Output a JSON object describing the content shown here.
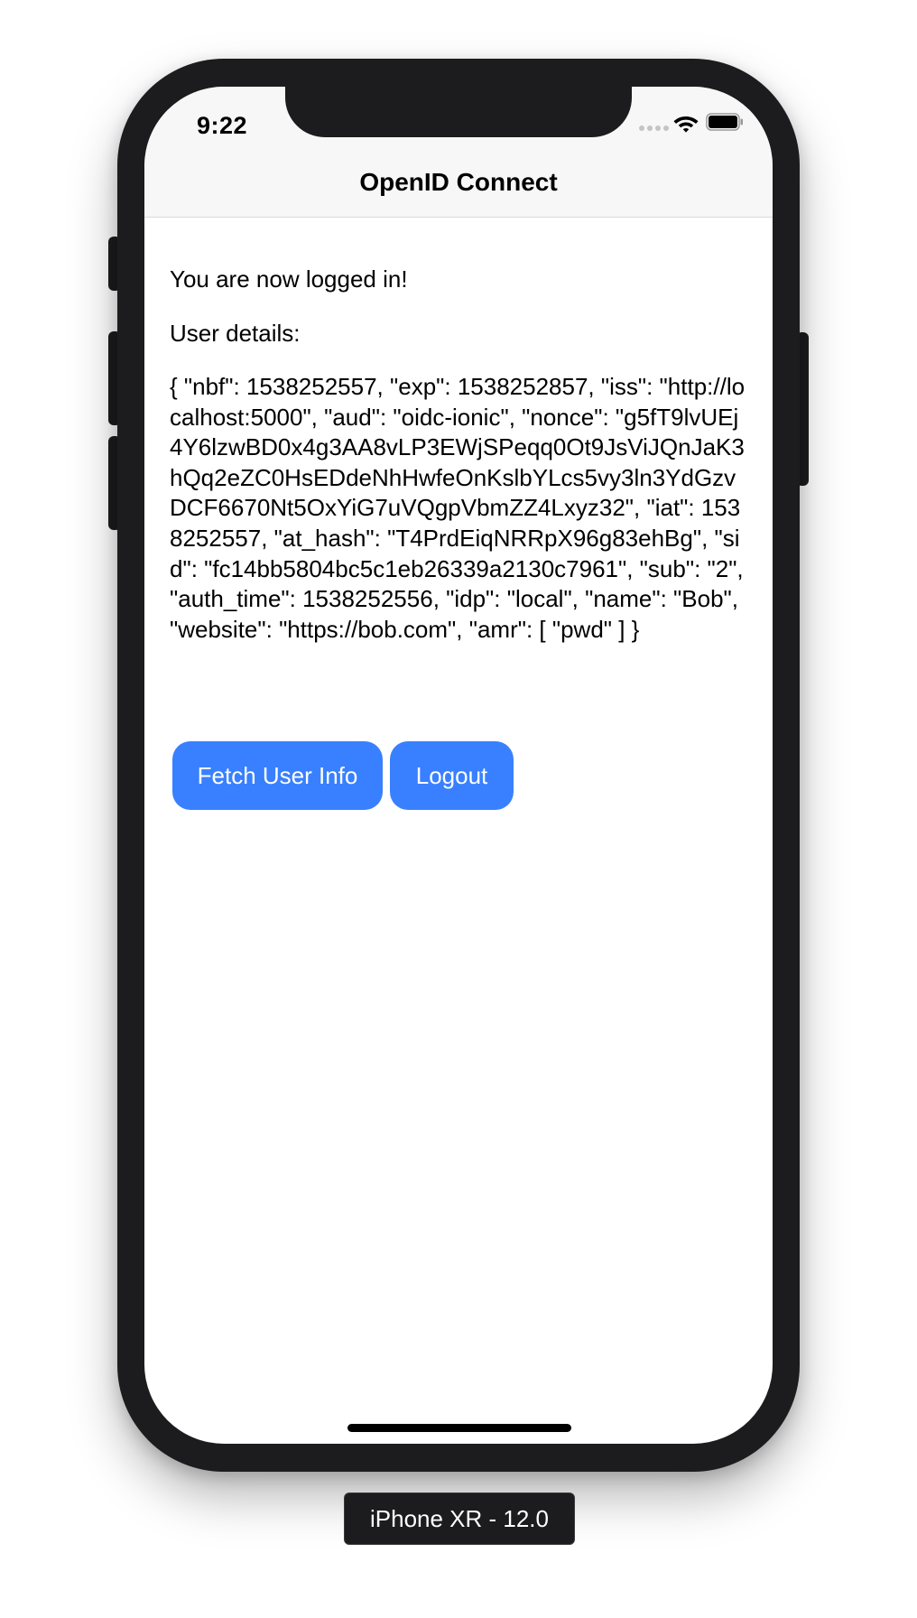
{
  "status_bar": {
    "time": "9:22"
  },
  "nav": {
    "title": "OpenID Connect"
  },
  "content": {
    "logged_in_message": "You are now logged in!",
    "details_label": "User details:",
    "details_json": "{ \"nbf\": 1538252557, \"exp\": 1538252857, \"iss\": \"http://localhost:5000\", \"aud\": \"oidc-ionic\", \"nonce\": \"g5fT9lvUEj4Y6lzwBD0x4g3AA8vLP3EWjSPeqq0Ot9JsViJQnJaK3hQq2eZC0HsEDdeNhHwfeOnKslbYLcs5vy3ln3YdGzvDCF6670Nt5OxYiG7uVQgpVbmZZ4Lxyz32\", \"iat\": 1538252557, \"at_hash\": \"T4PrdEiqNRRpX96g83ehBg\", \"sid\": \"fc14bb5804bc5c1eb26339a2130c7961\", \"sub\": \"2\", \"auth_time\": 1538252556, \"idp\": \"local\", \"name\": \"Bob\", \"website\": \"https://bob.com\", \"amr\": [ \"pwd\" ] }"
  },
  "buttons": {
    "fetch_user_info": "Fetch User Info",
    "logout": "Logout"
  },
  "device_label": "iPhone XR - 12.0",
  "colors": {
    "primary_button": "#3880ff",
    "device_frame": "#1c1c1e",
    "nav_background": "#f7f7f7"
  },
  "icons": {
    "signal": "cellular-signal-icon",
    "wifi": "wifi-icon",
    "battery": "battery-icon"
  }
}
